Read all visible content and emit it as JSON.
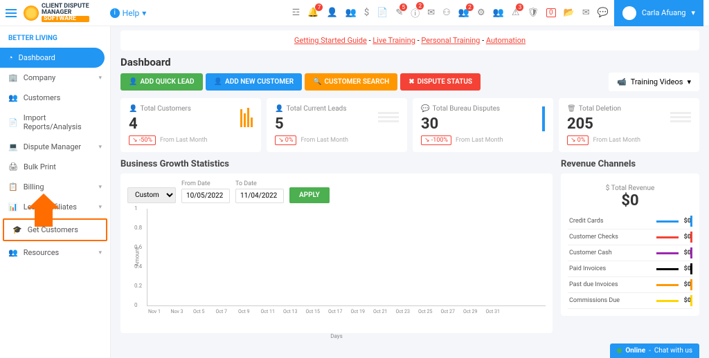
{
  "brand": "BETTER LIVING",
  "help": "Help",
  "user": "Carla Afuang",
  "icon_badges": {
    "bell": "7",
    "wand": "5",
    "info2": "2",
    "warn": "3"
  },
  "sidebar": {
    "items": [
      {
        "label": "Dashboard"
      },
      {
        "label": "Company"
      },
      {
        "label": "Customers"
      },
      {
        "label": "Import Reports/Analysis"
      },
      {
        "label": "Dispute Manager"
      },
      {
        "label": "Bulk Print"
      },
      {
        "label": "Billing"
      },
      {
        "label": "Leads/Affiliates"
      },
      {
        "label": "Get Customers"
      },
      {
        "label": "Resources"
      }
    ]
  },
  "alert": {
    "a1": "Getting Started Guide",
    "s": " - ",
    "a2": "Live Training",
    "a3": "Personal Training",
    "a4": "Automation"
  },
  "title": "Dashboard",
  "btns": {
    "quick": "ADD QUICK LEAD",
    "newcust": "ADD NEW CUSTOMER",
    "search": "CUSTOMER SEARCH",
    "dispute": "DISPUTE STATUS",
    "training": "Training Videos"
  },
  "cards": [
    {
      "t": "Total Customers",
      "v": "4",
      "p": "↘ -50%",
      "f": "From Last Month"
    },
    {
      "t": "Total Current Leads",
      "v": "5",
      "p": "↘ 0%",
      "f": "From Last Month"
    },
    {
      "t": "Total Bureau Disputes",
      "v": "30",
      "p": "↘ -100%",
      "f": "From Last Month"
    },
    {
      "t": "Total Deletion",
      "v": "205",
      "p": "↘ 0%",
      "f": "From Last Month"
    }
  ],
  "stats": {
    "t": "Business Growth Statistics",
    "sel": "Custom",
    "from_l": "From Date",
    "from": "10/05/2022",
    "to_l": "To Date",
    "to": "11/04/2022",
    "apply": "APPLY",
    "ylab": "Amount",
    "xlab": "Days"
  },
  "revenue": {
    "t": "Revenue Channels",
    "total_l": "Total Revenue",
    "total_v": "$0",
    "items": [
      {
        "l": "Credit Cards",
        "c": "#2196f3",
        "v": "$0"
      },
      {
        "l": "Customer Checks",
        "c": "#f44336",
        "v": "$0"
      },
      {
        "l": "Customer Cash",
        "c": "#9c27b0",
        "v": "$0"
      },
      {
        "l": "Paid Invoices",
        "c": "#000",
        "v": "$0"
      },
      {
        "l": "Past due Invoices",
        "c": "#ff9800",
        "v": "$0"
      },
      {
        "l": "Commissions Due",
        "c": "#ffd600",
        "v": "$0"
      }
    ]
  },
  "chart_data": {
    "type": "line",
    "title": "Business Growth Statistics",
    "xlabel": "Days",
    "ylabel": "Amount",
    "ylim": [
      0,
      1
    ],
    "yticks": [
      0,
      0.2,
      0.4,
      0.6,
      0.8,
      1
    ],
    "categories": [
      "Nov 1",
      "Nov 3",
      "Oct 5",
      "Oct 7",
      "Oct 9",
      "Oct 11",
      "Oct 13",
      "Oct 15",
      "Oct 17",
      "Oct 19",
      "Oct 21",
      "Oct 23",
      "Oct 25",
      "Oct 27",
      "Oct 29",
      "Oct 31"
    ],
    "values": [
      0,
      0,
      0,
      0,
      0,
      0,
      0,
      0,
      0,
      0,
      0,
      0,
      0,
      0,
      0,
      0
    ]
  },
  "chat": {
    "status": "Online",
    "msg": "Chat with us"
  }
}
